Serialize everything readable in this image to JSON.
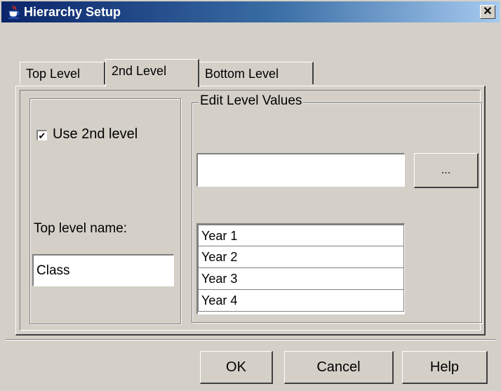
{
  "window": {
    "title": "Hierarchy Setup",
    "close_label": "✕"
  },
  "tabs": [
    {
      "label": "Top Level",
      "selected": false
    },
    {
      "label": "2nd Level",
      "selected": true
    },
    {
      "label": "Bottom Level",
      "selected": false
    }
  ],
  "left_panel": {
    "use_checkbox_label": "Use 2nd level",
    "use_checkbox_checked": true,
    "checkmark": "✔",
    "name_label": "Top level name:",
    "name_value": "Class"
  },
  "edit_values": {
    "group_title": "Edit Level Values",
    "input_value": "",
    "ellipsis_label": "...",
    "items": [
      "Year 1",
      "Year 2",
      "Year 3",
      "Year 4"
    ]
  },
  "buttons": {
    "ok": "OK",
    "cancel": "Cancel",
    "help": "Help"
  },
  "icons": {
    "title_icon": "java-coffee-cup-icon",
    "close_icon": "close-icon"
  },
  "colors": {
    "face": "#d4d0c8",
    "title_start": "#0a246a",
    "title_end": "#a6caf0"
  }
}
